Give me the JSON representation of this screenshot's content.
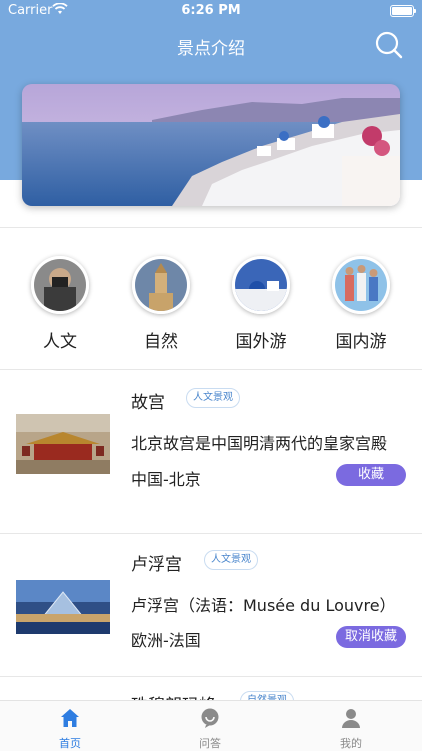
{
  "status_bar": {
    "carrier": "Carrier",
    "time": "6:26 PM"
  },
  "header": {
    "title": "景点介绍",
    "search_icon": "search-icon",
    "background_color": "#78a9de"
  },
  "categories": [
    {
      "label": "人文"
    },
    {
      "label": "自然"
    },
    {
      "label": "国外游"
    },
    {
      "label": "国内游"
    }
  ],
  "items": [
    {
      "name": "故宫",
      "tag": "人文景观",
      "description": "北京故宫是中国明清两代的皇家宫殿",
      "location": "中国-北京",
      "action": "收藏"
    },
    {
      "name": "卢浮宫",
      "tag": "人文景观",
      "description": "卢浮宫（法语：Musée du Louvre）",
      "location": "欧洲-法国",
      "action": "取消收藏"
    },
    {
      "name": "珠穆朗玛峰",
      "tag": "自然景观"
    }
  ],
  "tabs": [
    {
      "label": "首页",
      "icon": "home-icon",
      "active": true
    },
    {
      "label": "问答",
      "icon": "chat-icon",
      "active": false
    },
    {
      "label": "我的",
      "icon": "user-icon",
      "active": false
    }
  ],
  "colors": {
    "accent": "#2e7de1",
    "button": "#7b6ae0"
  }
}
